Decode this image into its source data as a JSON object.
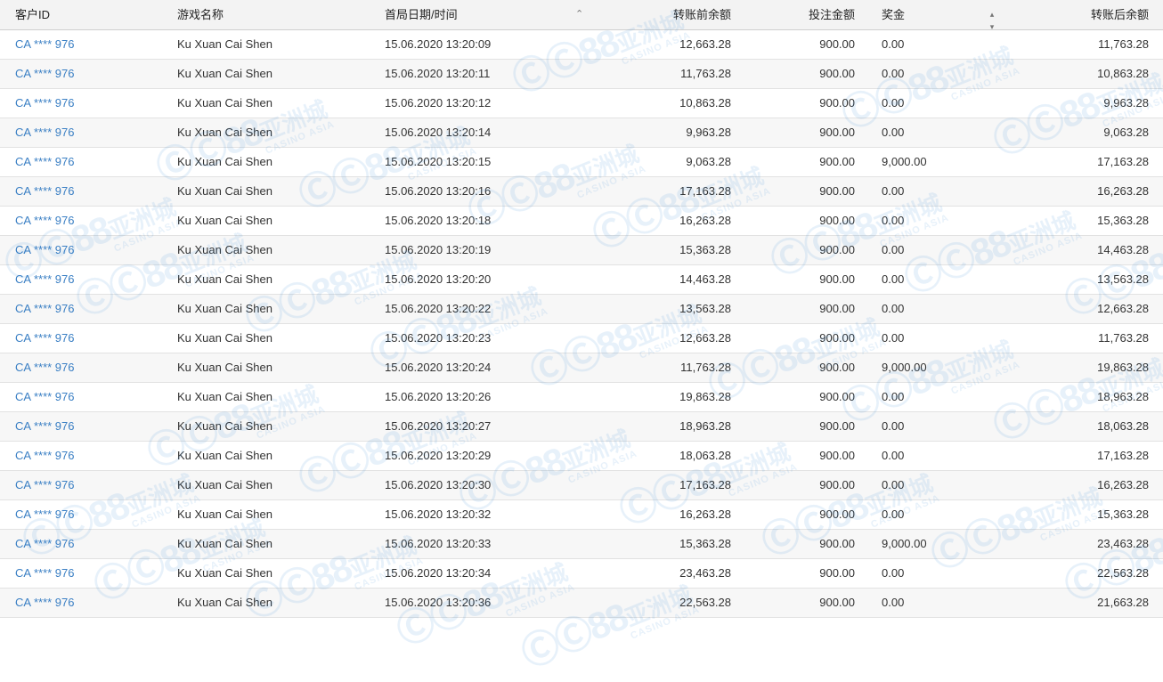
{
  "headers": {
    "customer_id": "客户ID",
    "game_name": "游戏名称",
    "first_datetime": "首局日期/时间",
    "balance_before": "转账前余额",
    "bet_amount": "投注金额",
    "bonus": "奖金",
    "balance_after": "转账后余额"
  },
  "icons": {
    "sort_asc": "chevron-up-icon",
    "sort_both": "sort-icon"
  },
  "colors": {
    "link": "#3a7fc4",
    "watermark": "#2f86d6"
  },
  "watermark": {
    "brand": "88",
    "cn": "亚洲城",
    "en": "CASINO ASIA"
  },
  "rows": [
    {
      "id": "CA **** 976",
      "game": "Ku Xuan Cai Shen",
      "time": "15.06.2020 13:20:09",
      "before": "12,663.28",
      "bet": "900.00",
      "bonus": "0.00",
      "after": "11,763.28"
    },
    {
      "id": "CA **** 976",
      "game": "Ku Xuan Cai Shen",
      "time": "15.06.2020 13:20:11",
      "before": "11,763.28",
      "bet": "900.00",
      "bonus": "0.00",
      "after": "10,863.28"
    },
    {
      "id": "CA **** 976",
      "game": "Ku Xuan Cai Shen",
      "time": "15.06.2020 13:20:12",
      "before": "10,863.28",
      "bet": "900.00",
      "bonus": "0.00",
      "after": "9,963.28"
    },
    {
      "id": "CA **** 976",
      "game": "Ku Xuan Cai Shen",
      "time": "15.06.2020 13:20:14",
      "before": "9,963.28",
      "bet": "900.00",
      "bonus": "0.00",
      "after": "9,063.28"
    },
    {
      "id": "CA **** 976",
      "game": "Ku Xuan Cai Shen",
      "time": "15.06.2020 13:20:15",
      "before": "9,063.28",
      "bet": "900.00",
      "bonus": "9,000.00",
      "after": "17,163.28"
    },
    {
      "id": "CA **** 976",
      "game": "Ku Xuan Cai Shen",
      "time": "15.06.2020 13:20:16",
      "before": "17,163.28",
      "bet": "900.00",
      "bonus": "0.00",
      "after": "16,263.28"
    },
    {
      "id": "CA **** 976",
      "game": "Ku Xuan Cai Shen",
      "time": "15.06.2020 13:20:18",
      "before": "16,263.28",
      "bet": "900.00",
      "bonus": "0.00",
      "after": "15,363.28"
    },
    {
      "id": "CA **** 976",
      "game": "Ku Xuan Cai Shen",
      "time": "15.06.2020 13:20:19",
      "before": "15,363.28",
      "bet": "900.00",
      "bonus": "0.00",
      "after": "14,463.28"
    },
    {
      "id": "CA **** 976",
      "game": "Ku Xuan Cai Shen",
      "time": "15.06.2020 13:20:20",
      "before": "14,463.28",
      "bet": "900.00",
      "bonus": "0.00",
      "after": "13,563.28"
    },
    {
      "id": "CA **** 976",
      "game": "Ku Xuan Cai Shen",
      "time": "15.06.2020 13:20:22",
      "before": "13,563.28",
      "bet": "900.00",
      "bonus": "0.00",
      "after": "12,663.28"
    },
    {
      "id": "CA **** 976",
      "game": "Ku Xuan Cai Shen",
      "time": "15.06.2020 13:20:23",
      "before": "12,663.28",
      "bet": "900.00",
      "bonus": "0.00",
      "after": "11,763.28"
    },
    {
      "id": "CA **** 976",
      "game": "Ku Xuan Cai Shen",
      "time": "15.06.2020 13:20:24",
      "before": "11,763.28",
      "bet": "900.00",
      "bonus": "9,000.00",
      "after": "19,863.28"
    },
    {
      "id": "CA **** 976",
      "game": "Ku Xuan Cai Shen",
      "time": "15.06.2020 13:20:26",
      "before": "19,863.28",
      "bet": "900.00",
      "bonus": "0.00",
      "after": "18,963.28"
    },
    {
      "id": "CA **** 976",
      "game": "Ku Xuan Cai Shen",
      "time": "15.06.2020 13:20:27",
      "before": "18,963.28",
      "bet": "900.00",
      "bonus": "0.00",
      "after": "18,063.28"
    },
    {
      "id": "CA **** 976",
      "game": "Ku Xuan Cai Shen",
      "time": "15.06.2020 13:20:29",
      "before": "18,063.28",
      "bet": "900.00",
      "bonus": "0.00",
      "after": "17,163.28"
    },
    {
      "id": "CA **** 976",
      "game": "Ku Xuan Cai Shen",
      "time": "15.06.2020 13:20:30",
      "before": "17,163.28",
      "bet": "900.00",
      "bonus": "0.00",
      "after": "16,263.28"
    },
    {
      "id": "CA **** 976",
      "game": "Ku Xuan Cai Shen",
      "time": "15.06.2020 13:20:32",
      "before": "16,263.28",
      "bet": "900.00",
      "bonus": "0.00",
      "after": "15,363.28"
    },
    {
      "id": "CA **** 976",
      "game": "Ku Xuan Cai Shen",
      "time": "15.06.2020 13:20:33",
      "before": "15,363.28",
      "bet": "900.00",
      "bonus": "9,000.00",
      "after": "23,463.28"
    },
    {
      "id": "CA **** 976",
      "game": "Ku Xuan Cai Shen",
      "time": "15.06.2020 13:20:34",
      "before": "23,463.28",
      "bet": "900.00",
      "bonus": "0.00",
      "after": "22,563.28"
    },
    {
      "id": "CA **** 976",
      "game": "Ku Xuan Cai Shen",
      "time": "15.06.2020 13:20:36",
      "before": "22,563.28",
      "bet": "900.00",
      "bonus": "0.00",
      "after": "21,663.28"
    }
  ]
}
